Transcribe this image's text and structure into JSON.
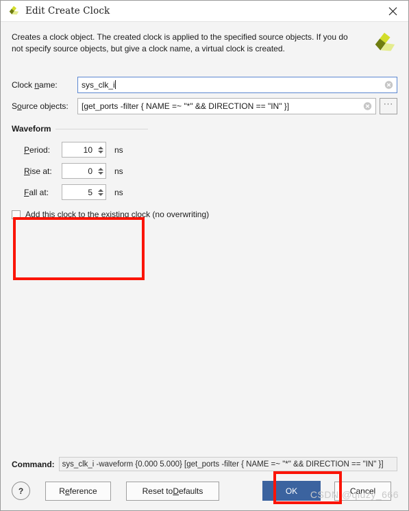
{
  "window": {
    "title": "Edit Create Clock",
    "logo_icon": "vivado-logo-icon",
    "close_icon": "close-icon"
  },
  "description": {
    "text": "Creates a clock object. The created clock is applied to the specified source objects. If you do not specify source objects, but give a clock name, a virtual clock is created.",
    "logo_icon": "vivado-logo-icon"
  },
  "form": {
    "clock_name": {
      "label_pre": "Clock ",
      "label_mnemonic": "n",
      "label_post": "ame:",
      "value": "sys_clk_i",
      "clear_icon": "clear-circle-icon"
    },
    "source_objects": {
      "label_pre": "S",
      "label_mnemonic": "o",
      "label_post": "urce objects:",
      "value": "[get_ports -filter { NAME =~  \"*\" && DIRECTION == \"IN\" }]",
      "clear_icon": "clear-circle-icon",
      "browse_label": "···"
    }
  },
  "waveform": {
    "group_title": "Waveform",
    "rows": [
      {
        "label_pre": "",
        "label_mnemonic": "P",
        "label_post": "eriod:",
        "value": "10",
        "unit": "ns"
      },
      {
        "label_pre": "",
        "label_mnemonic": "R",
        "label_post": "ise at:",
        "value": "0",
        "unit": "ns"
      },
      {
        "label_pre": "",
        "label_mnemonic": "F",
        "label_post": "all at:",
        "value": "5",
        "unit": "ns"
      }
    ]
  },
  "add_clock_checkbox": {
    "label_pre": "",
    "label_mnemonic": "A",
    "label_post": "dd this clock to the existing clock (no overwriting)",
    "checked": false
  },
  "command": {
    "label": "Command:",
    "value": "sys_clk_i -waveform {0.000 5.000} [get_ports -filter { NAME =~  \"*\" && DIRECTION == \"IN\" }]"
  },
  "buttons": {
    "help": "?",
    "reference_pre": "R",
    "reference_mnemonic": "e",
    "reference_post": "ference",
    "reset_pre": "Reset to ",
    "reset_mnemonic": "D",
    "reset_post": "efaults",
    "ok": "OK",
    "cancel": "Cancel"
  },
  "watermark": "CSDN @qiuzy_666",
  "colors": {
    "accent_blue": "#3b639f",
    "annotation_red": "#fb1406",
    "focus_border": "#5b87d0",
    "dialog_bg": "#f4f4f4",
    "logo_dark": "#6f7d10",
    "logo_bright": "#d2dd2a",
    "logo_pale": "#e4ec8e"
  }
}
